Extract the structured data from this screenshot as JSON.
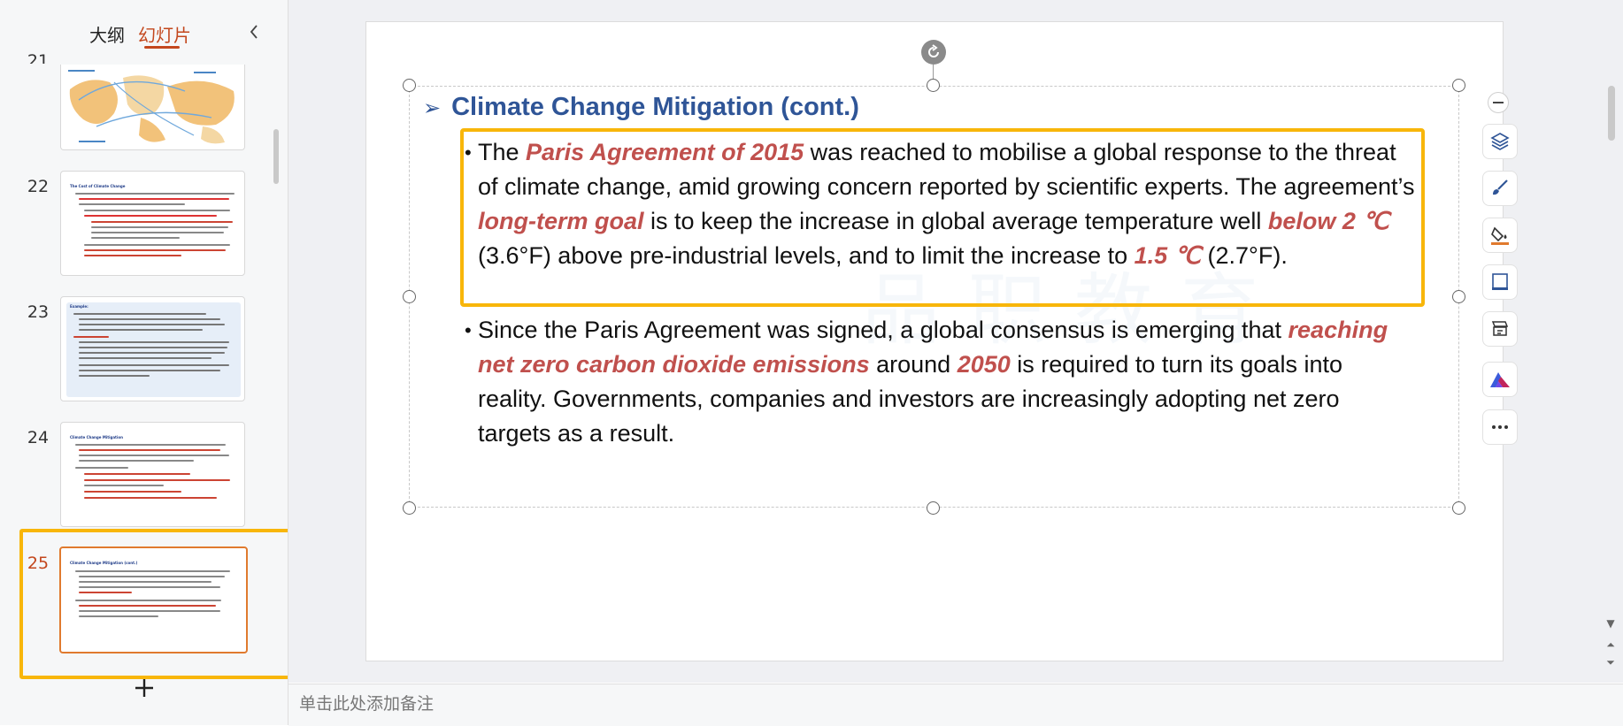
{
  "panel": {
    "tab_outline": "大纲",
    "tab_slides": "幻灯片",
    "collapse_icon": "chevron-left-icon",
    "slides": [
      {
        "number": "21",
        "title": ""
      },
      {
        "number": "22",
        "title": "The Cost of Climate Change"
      },
      {
        "number": "23",
        "title": "Example:"
      },
      {
        "number": "24",
        "title": "Climate Change Mitigation"
      },
      {
        "number": "25",
        "title": "Climate Change Mitigation (cont.)"
      }
    ],
    "selected_slide": "25",
    "add_slide_icon": "plus-icon"
  },
  "slide": {
    "title": "Climate Change Mitigation (cont.)",
    "bullet1": {
      "t1": "The ",
      "em1": "Paris Agreement of 2015",
      "t2": " was reached to mobilise a global response to the threat of climate change, amid growing concern reported by scientific experts. The agreement’s ",
      "em2": "long-term goal",
      "t3": " is to keep the increase in global average temperature well ",
      "em3": "below 2 ℃",
      "t4": " (3.6°F) above pre-industrial levels, and to limit the increase to ",
      "em4": "1.5 ℃",
      "t5": " (2.7°F)."
    },
    "bullet2": {
      "t1": "Since the Paris Agreement was signed, a global consensus is emerging that ",
      "em1": "reaching net zero carbon dioxide emissions",
      "t2": " around ",
      "em2": "2050",
      "t3": " is required to turn its goals into reality. Governments, companies and investors are increasingly adopting net zero targets as a result."
    },
    "watermark": "品职教育"
  },
  "toolbar": [
    "minus-icon",
    "layers-icon",
    "brush-icon",
    "fill-icon",
    "frame-icon",
    "slide-edit-icon",
    "ai-logo-icon",
    "more-icon"
  ],
  "notes": {
    "placeholder": "单击此处添加备注"
  },
  "colors": {
    "accent": "#c3471d",
    "highlight": "#f8b60a",
    "title": "#2f5597",
    "emphasis": "#c0504d"
  }
}
